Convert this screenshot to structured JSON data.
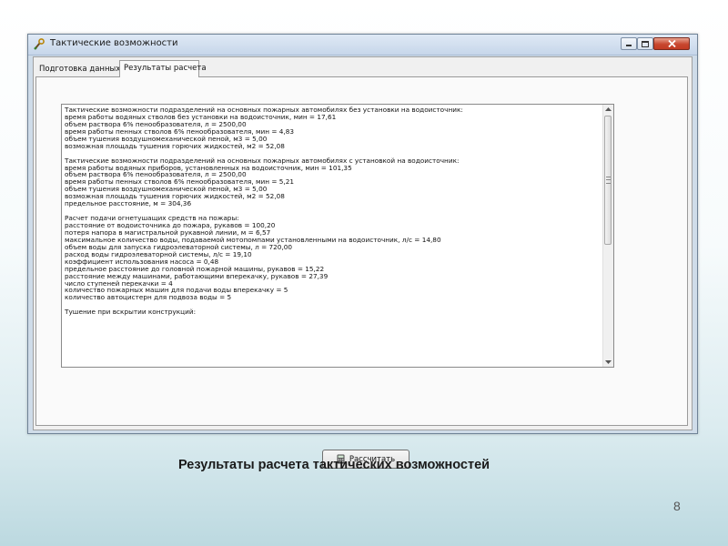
{
  "window": {
    "title": "Тактические возможности",
    "icons": {
      "app": "wrench-app-icon",
      "minimize": "minimize-icon",
      "maximize": "maximize-icon",
      "close": "close-icon"
    }
  },
  "tabs": [
    {
      "label": "Подготовка данных",
      "active": false
    },
    {
      "label": "Результаты расчета",
      "active": true
    }
  ],
  "results": {
    "lines": [
      "Тактические возможности подразделений на основных пожарных автомобилях без установки на водоисточник:",
      "время работы водяных стволов без установки на водоисточник, мин = 17,61",
      "объем раствора 6% пенообразователя, л = 2500,00",
      "время работы пенных стволов 6% пенообразователя, мин =   4,83",
      "объем тушения воздушномеханической пеной, м3 =   5,00",
      "возможная площадь тушения горючих жидкостей, м2 =  52,08",
      "",
      "Тактические возможности подразделений на основных пожарных автомобилях с установкой на водоисточник:",
      "время работы водяных приборов, установленных на водоисточник, мин = 101,35",
      "объем раствора 6% пенообразователя, л = 2500,00",
      "время работы пенных стволов 6% пенообразователя, мин =   5,21",
      "объем тушения воздушномеханической пеной, м3 =   5,00",
      "возможная площадь тушения горючих жидкостей, м2 =  52,08",
      "предельное расстояние, м = 304,36",
      "",
      "Расчет подачи огнетушащих средств на пожары:",
      "расстояние от водоисточника до пожара, рукавов = 100,20",
      "потеря напора в магистральной рукавной линии, м =   6,57",
      "максимальное количество воды, подаваемой мотопомпами установленными на водоисточник, л/с = 14,80",
      "объем воды для запуска гидроэлеваторной системы, л = 720,00",
      "расход воды гидроэлеваторной системы, л/с =  19,10",
      "коэффициент использования насоса =   0,48",
      "предельное расстояние до головной пожарной машины, рукавов =  15,22",
      "расстояние между машинами, работающими вперекачку, рукавов =  27,39",
      "число ступеней перекачки = 4",
      "количество пожарных машин для подачи воды вперекачку = 5",
      "количество автоцистерн для подвоза воды = 5",
      "",
      "Тушение при вскрытии конструкций:"
    ]
  },
  "calc_button": {
    "label": "Рассчитать",
    "icon": "calculator-icon"
  },
  "caption": "Результаты расчета тактических возможностей",
  "slide_number": "8"
}
